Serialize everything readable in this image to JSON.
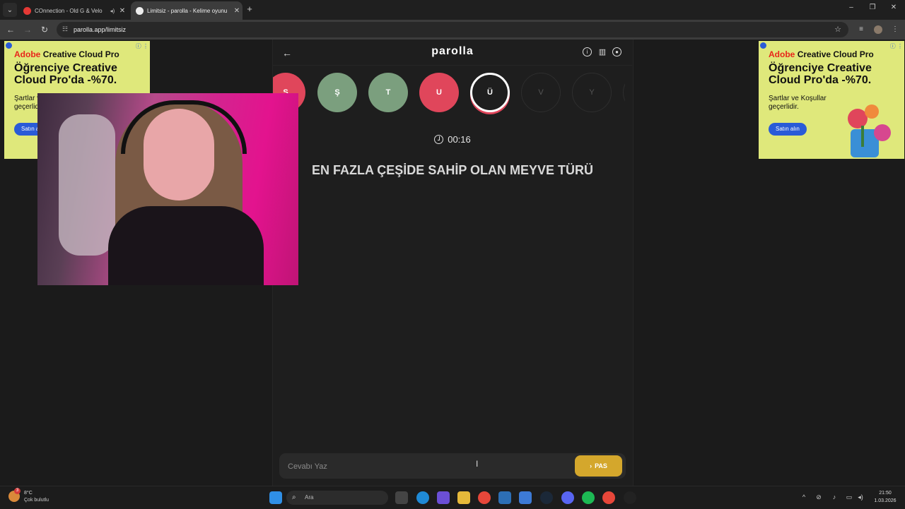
{
  "browser": {
    "tabs": [
      {
        "title": "COnnection - Old G & Velo",
        "active": false,
        "has_audio": true
      },
      {
        "title": "Limitsiz - parolla - Kelime oyunu",
        "active": true,
        "has_audio": false
      }
    ],
    "url": "parolla.app/limitsiz"
  },
  "ads": {
    "left": {
      "brand_prefix": "Adobe",
      "brand_suffix": "Creative Cloud Pro",
      "headline": "Öğrenciye Creative Cloud Pro'da -%70.",
      "terms": "Şartlar ve Koşullar geçerlidir.",
      "cta": "Satın alın"
    },
    "right": {
      "brand_prefix": "Adobe",
      "brand_suffix": "Creative Cloud Pro",
      "headline": "Öğrenciye Creative Cloud Pro'da -%70.",
      "terms": "Şartlar ve Koşullar geçerlidir.",
      "cta": "Satın alın"
    }
  },
  "app": {
    "logo": "parolla",
    "letters": [
      {
        "char": "S",
        "state": "red"
      },
      {
        "char": "Ş",
        "state": "green"
      },
      {
        "char": "T",
        "state": "green"
      },
      {
        "char": "U",
        "state": "red"
      },
      {
        "char": "Ü",
        "state": "current"
      },
      {
        "char": "V",
        "state": "pending"
      },
      {
        "char": "Y",
        "state": "pending"
      }
    ],
    "timer": "00:16",
    "question": "EN FAZLA ÇEŞİDE SAHİP OLAN MEYVE TÜRÜ",
    "answer_placeholder": "Cevabı Yaz",
    "pass_label": "PAS"
  },
  "colors": {
    "correct": "#7b9f7e",
    "wrong": "#e0465b",
    "pass_button": "#d4a72c",
    "ad_background": "#dfe87b"
  },
  "taskbar": {
    "weather_temp": "8°C",
    "weather_condition": "Çok bulutlu",
    "weather_badge": "3",
    "search_placeholder": "Ara",
    "time": "21:50",
    "date": "1.03.2026"
  }
}
